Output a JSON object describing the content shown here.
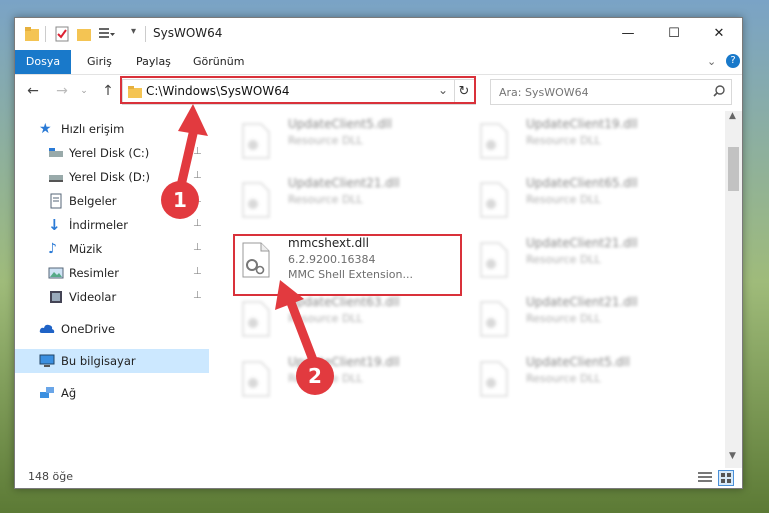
{
  "window": {
    "title": "SysWOW64",
    "min_label": "—",
    "max_label": "☐",
    "close_label": "✕"
  },
  "ribbon": {
    "tabs": [
      {
        "label": "Dosya",
        "active": true
      },
      {
        "label": "Giriş"
      },
      {
        "label": "Paylaş"
      },
      {
        "label": "Görünüm"
      }
    ],
    "expand_label": "⌄",
    "help_label": "?"
  },
  "nav": {
    "back": "←",
    "forward": "→",
    "up": "↑",
    "address": "C:\\Windows\\SysWOW64",
    "dropdown": "⌄",
    "refresh": "↻",
    "search_placeholder": "Ara: SysWOW64"
  },
  "sidebar": {
    "items": [
      {
        "label": "Hızlı erişim",
        "icon": "star-icon"
      },
      {
        "label": "Yerel Disk (C:)",
        "icon": "drive-icon",
        "pinned": true
      },
      {
        "label": "Yerel Disk (D:)",
        "icon": "drive-icon",
        "pinned": true
      },
      {
        "label": "Belgeler",
        "icon": "documents-icon",
        "pinned": true
      },
      {
        "label": "İndirmeler",
        "icon": "download-icon",
        "pinned": true
      },
      {
        "label": "Müzik",
        "icon": "music-icon",
        "pinned": true
      },
      {
        "label": "Resimler",
        "icon": "pictures-icon",
        "pinned": true
      },
      {
        "label": "Videolar",
        "icon": "videos-icon",
        "pinned": true
      },
      {
        "label": "OneDrive",
        "icon": "cloud-icon"
      },
      {
        "label": "Bu bilgisayar",
        "icon": "computer-icon",
        "selected": true
      },
      {
        "label": "Ağ",
        "icon": "network-icon"
      }
    ],
    "pin_glyph": "📌"
  },
  "files": {
    "left": [
      {
        "name": "UpdateClient5.dll",
        "desc": "Resource DLL"
      },
      {
        "name": "UpdateClient21.dll",
        "desc": "Resource DLL"
      },
      {
        "name": "mmcshext.dll",
        "version": "6.2.9200.16384",
        "desc": "MMC Shell Extension...",
        "focus": true
      },
      {
        "name": "UpdateClient63.dll",
        "desc": "Resource DLL"
      },
      {
        "name": "UpdateClient19.dll",
        "desc": "Resource DLL"
      }
    ],
    "right": [
      {
        "name": "UpdateClient19.dll",
        "desc": "Resource DLL"
      },
      {
        "name": "UpdateClient65.dll",
        "desc": "Resource DLL"
      },
      {
        "name": "UpdateClient21.dll",
        "desc": "Resource DLL"
      },
      {
        "name": "UpdateClient21.dll",
        "desc": "Resource DLL"
      },
      {
        "name": "UpdateClient5.dll",
        "desc": "Resource DLL"
      }
    ]
  },
  "status": {
    "count": "148 öğe"
  },
  "annotations": {
    "step1": "1",
    "step2": "2",
    "color": "#e23a3f"
  }
}
